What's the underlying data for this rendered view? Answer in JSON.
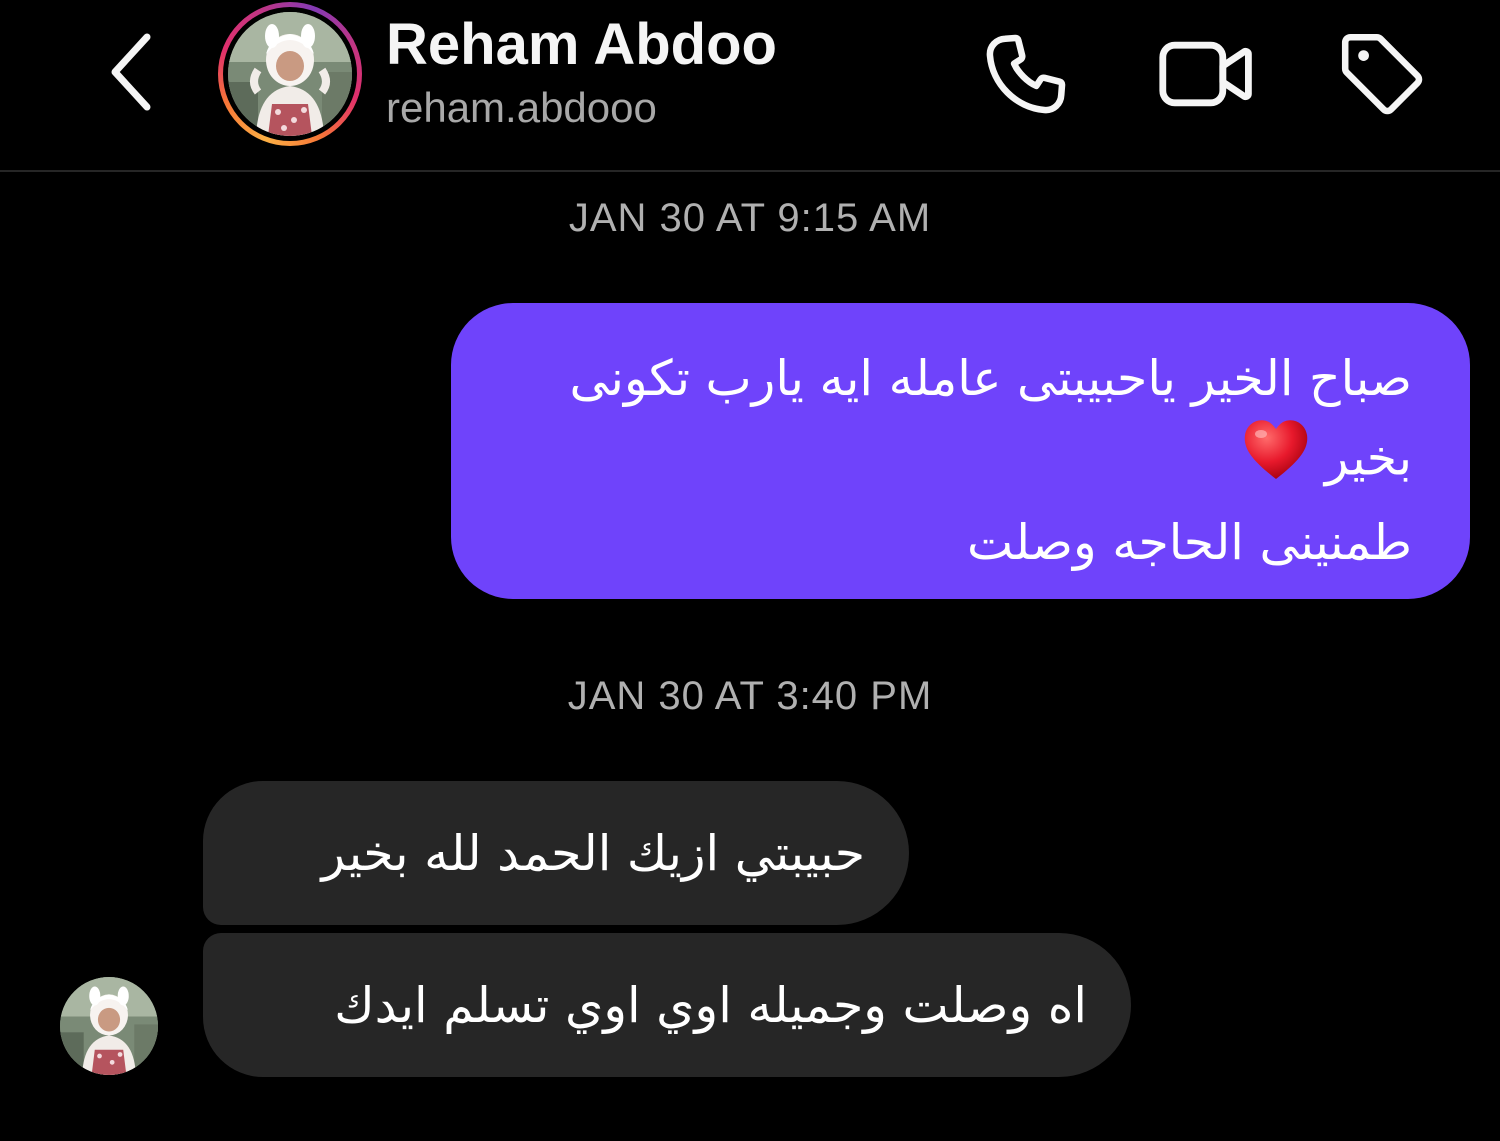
{
  "header": {
    "display_name": "Reham Abdoo",
    "username": "reham.abdooo",
    "icons": {
      "back": "chevron-left-icon",
      "call": "phone-icon",
      "video": "video-camera-icon",
      "tag": "tag-icon"
    }
  },
  "thread": {
    "timestamp_1": "JAN 30 AT 9:15 AM",
    "sent_message": {
      "line_1": "صباح الخير ياحبيبتى عامله ايه يارب تكونى",
      "line_2": "بخير",
      "line_2_emoji": "red-heart-emoji",
      "line_3": "طمنينى الحاجه وصلت"
    },
    "timestamp_2": "JAN 30 AT 3:40 PM",
    "received_messages": [
      {
        "text": "حبيبتي ازيك  الحمد لله بخير"
      },
      {
        "text": "اه وصلت وجميله اوي اوي تسلم ايدك"
      }
    ]
  },
  "colors": {
    "background": "#000000",
    "sent_bubble": "#6f43fb",
    "received_bubble": "#262626",
    "timestamp_text": "#b0b0b0",
    "username_text": "#a8a8a8"
  }
}
